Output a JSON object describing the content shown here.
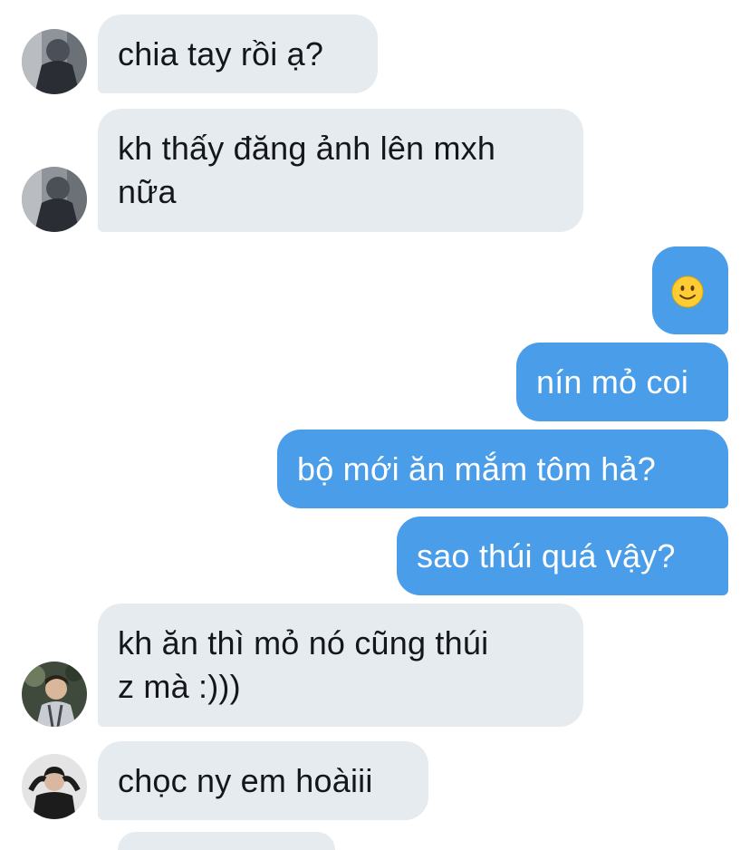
{
  "conversation": {
    "messages": [
      {
        "from": "other",
        "text": "chia tay rồi ạ?"
      },
      {
        "from": "other",
        "text": "kh thấy đăng ảnh lên mxh",
        "text2": "nữa"
      },
      {
        "from": "me",
        "emoji": "slightly-smiling-face-icon"
      },
      {
        "from": "me",
        "text": "nín mỏ coi"
      },
      {
        "from": "me",
        "text": "bộ mới ăn mắm tôm hả?"
      },
      {
        "from": "me",
        "text": "sao thúi quá vậy?"
      },
      {
        "from": "other",
        "text": "kh ăn thì mỏ nó cũng thúi",
        "text2": "z mà :)))"
      },
      {
        "from": "other",
        "text": "chọc ny em hoàiii"
      }
    ]
  },
  "colors": {
    "incoming_bubble": "#e6ebef",
    "outgoing_bubble": "#4a9de8",
    "incoming_text": "#14171a",
    "outgoing_text": "#ffffff"
  }
}
